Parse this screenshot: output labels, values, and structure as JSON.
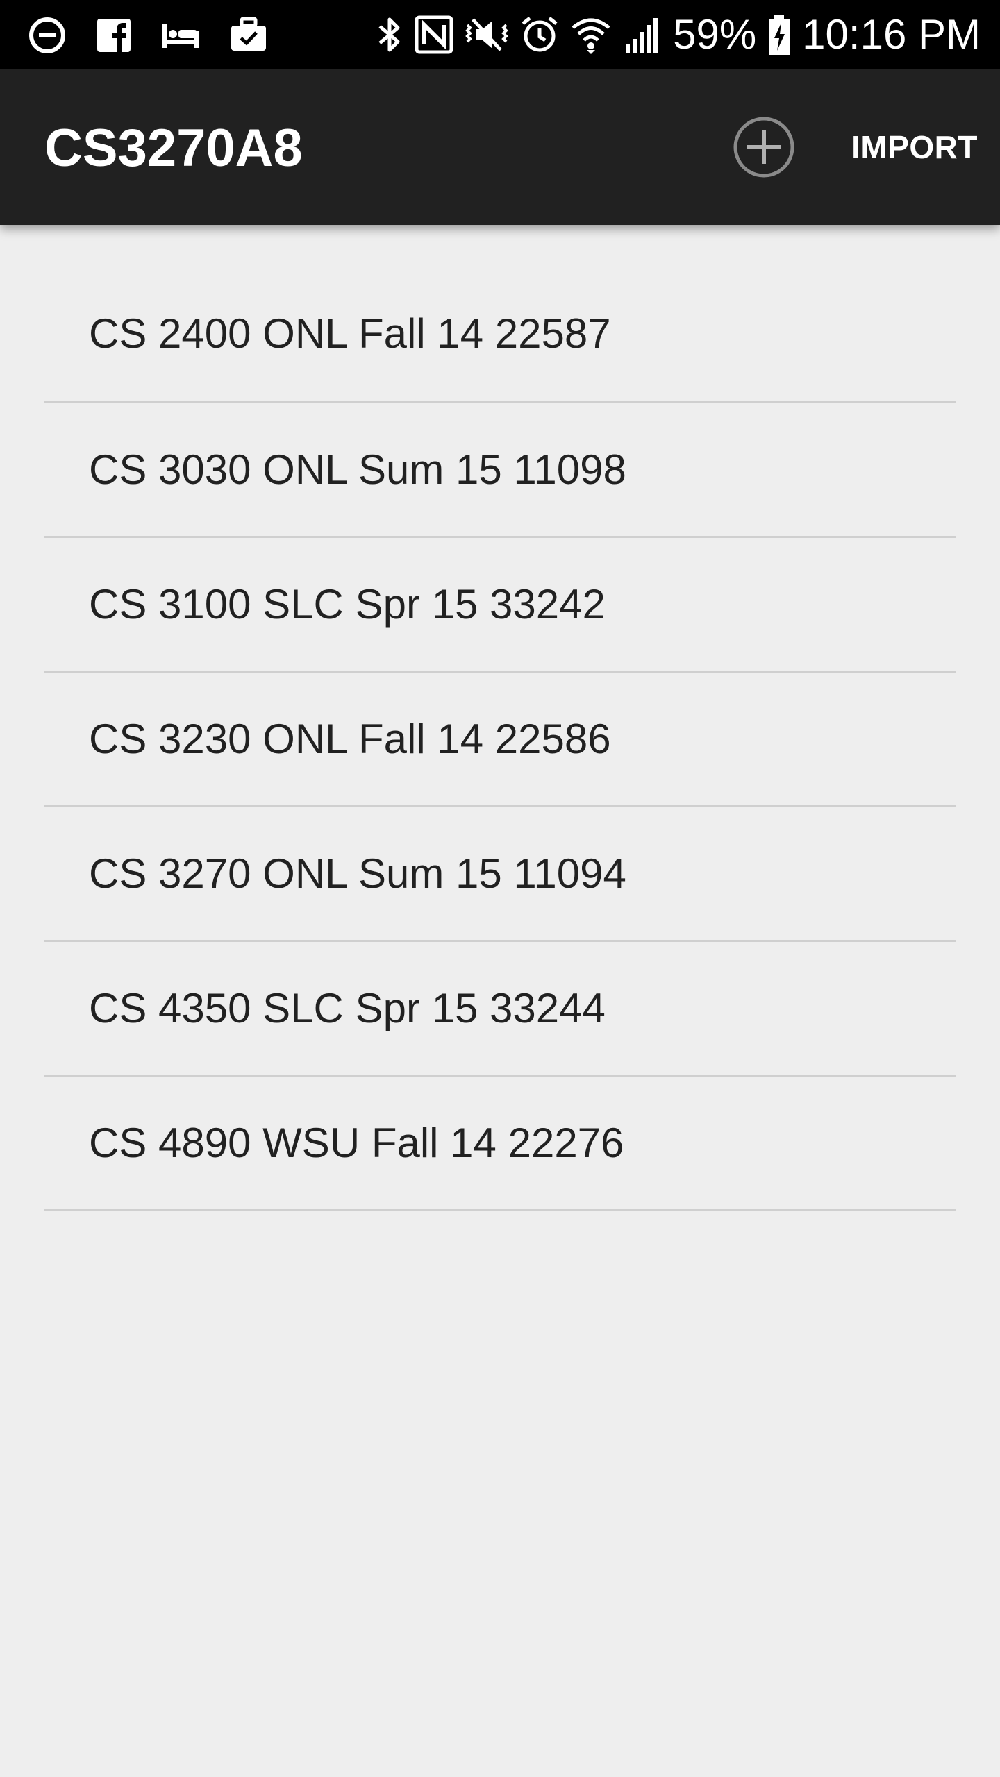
{
  "status_bar": {
    "battery": "59%",
    "time": "10:16 PM",
    "icons": [
      "do-not-disturb-icon",
      "facebook-icon",
      "hotel-icon",
      "work-icon",
      "bluetooth-icon",
      "nfc-icon",
      "vibrate-icon",
      "alarm-icon",
      "wifi-icon",
      "signal-icon",
      "battery-charging-icon"
    ]
  },
  "app_bar": {
    "title": "CS3270A8",
    "add_icon": "add-circle-icon",
    "import_label": "IMPORT"
  },
  "courses": [
    {
      "label": "CS 2400 ONL Fall 14 22587"
    },
    {
      "label": "CS 3030 ONL Sum 15 11098"
    },
    {
      "label": "CS 3100 SLC Spr 15 33242"
    },
    {
      "label": "CS 3230 ONL Fall 14 22586"
    },
    {
      "label": "CS 3270 ONL Sum 15 11094"
    },
    {
      "label": "CS 4350 SLC Spr 15 33244"
    },
    {
      "label": "CS 4890 WSU Fall 14 22276"
    }
  ],
  "colors": {
    "status_bar": "#000000",
    "app_bar": "#212121",
    "background": "#eeeeee",
    "divider": "#cfcfcf",
    "text_primary": "#212121"
  }
}
